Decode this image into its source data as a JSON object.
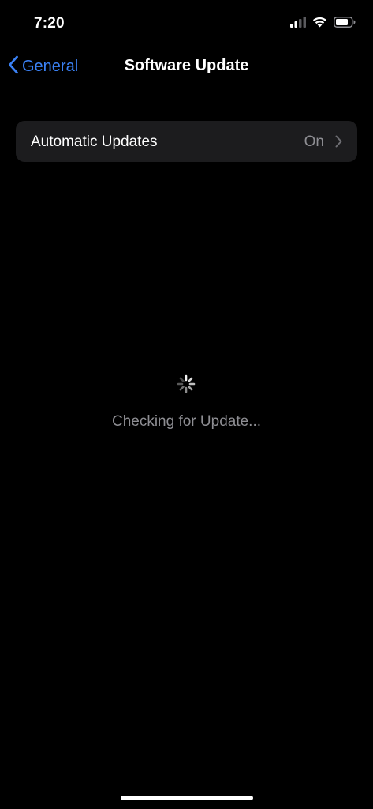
{
  "status_bar": {
    "time": "7:20",
    "icons": [
      "cellular-signal-icon",
      "wifi-icon",
      "battery-icon"
    ]
  },
  "nav": {
    "back_label": "General",
    "title": "Software Update"
  },
  "settings": {
    "automatic_updates": {
      "label": "Automatic Updates",
      "value": "On"
    }
  },
  "status": {
    "checking_text": "Checking for Update..."
  },
  "colors": {
    "background": "#000000",
    "accent": "#3b82f6",
    "group_background": "#1c1c1e",
    "secondary_text": "#8e8e93"
  }
}
